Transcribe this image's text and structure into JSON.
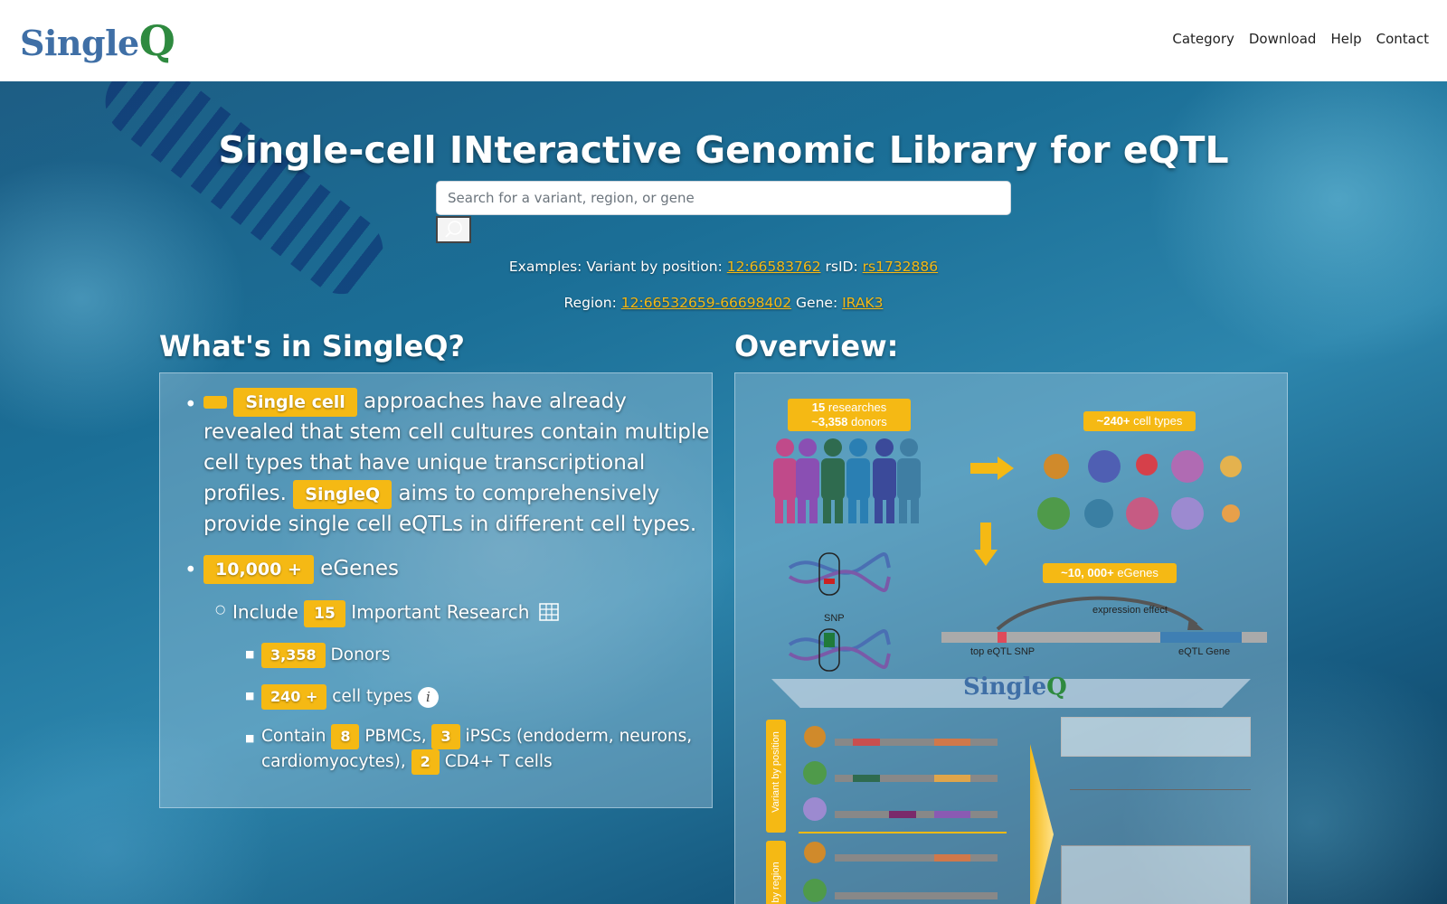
{
  "header": {
    "logo_text": "Single",
    "logo_q": "Q",
    "nav": [
      "Category",
      "Download",
      "Help",
      "Contact"
    ]
  },
  "hero": {
    "title_parts": [
      {
        "b": "S",
        "t": "ingle-cell "
      },
      {
        "b": "IN",
        "t": "teractive "
      },
      {
        "b": "G",
        "t": "enomic "
      },
      {
        "b": "L",
        "t": "ibrary for "
      },
      {
        "b": "eQ",
        "t": "TL"
      }
    ],
    "search_placeholder": "Search for a variant, region, or gene",
    "examples_line1": {
      "prefix": "Examples: Variant by position:",
      "variant": "12:66583762",
      "rsid_label": "rsID:",
      "rsid": "rs1732886"
    },
    "examples_line2": {
      "region_label": "Region:",
      "region": "12:66532659-66698402",
      "gene_label": "Gene:",
      "gene": "IRAK3"
    }
  },
  "whats_in": {
    "heading": "What's in SingleQ?",
    "intro": {
      "badge1": "Single cell",
      "text1": "approaches have already revealed that stem cell cultures contain multiple cell types that have unique transcriptional profiles.",
      "badge2": "SingleQ",
      "text2": "aims to comprehensively provide single cell eQTLs in different cell types."
    },
    "egenes": {
      "badge": "10,000 +",
      "label": "eGenes"
    },
    "include": {
      "prefix": "Include",
      "badge": "15",
      "label": "Important Research"
    },
    "donors": {
      "badge": "3,358",
      "label": "Donors"
    },
    "celltypes": {
      "badge": "240 +",
      "label": "cell types"
    },
    "contain": {
      "prefix": "Contain",
      "pbmc_badge": "8",
      "pbmc_label": "PBMCs,",
      "ipsc_badge": "3",
      "ipsc_label": "iPSCs (endoderm, neurons, cardiomyocytes),",
      "cd4_badge": "2",
      "cd4_label": "CD4+ T cells"
    }
  },
  "overview": {
    "heading": "Overview:",
    "researchers": {
      "num": "15",
      "text": "researches"
    },
    "donors": {
      "num": "~3,358",
      "text": "donors"
    },
    "celltypes": {
      "num": "~240+",
      "text": "cell types"
    },
    "egenes": {
      "num": "~10, 000+",
      "text": "eGenes"
    },
    "snp_label": "SNP",
    "expression_effect": "expression effect",
    "top_snp": "top eQTL SNP",
    "eqtl_gene": "eQTL Gene",
    "banner_text": "Single",
    "banner_q": "Q",
    "side_label_position": "Variant by position",
    "side_label_region": "by region",
    "colors": {
      "accent": "#f5b914",
      "brand_blue": "#3f6fa6",
      "brand_green": "#2e8a3f"
    }
  }
}
